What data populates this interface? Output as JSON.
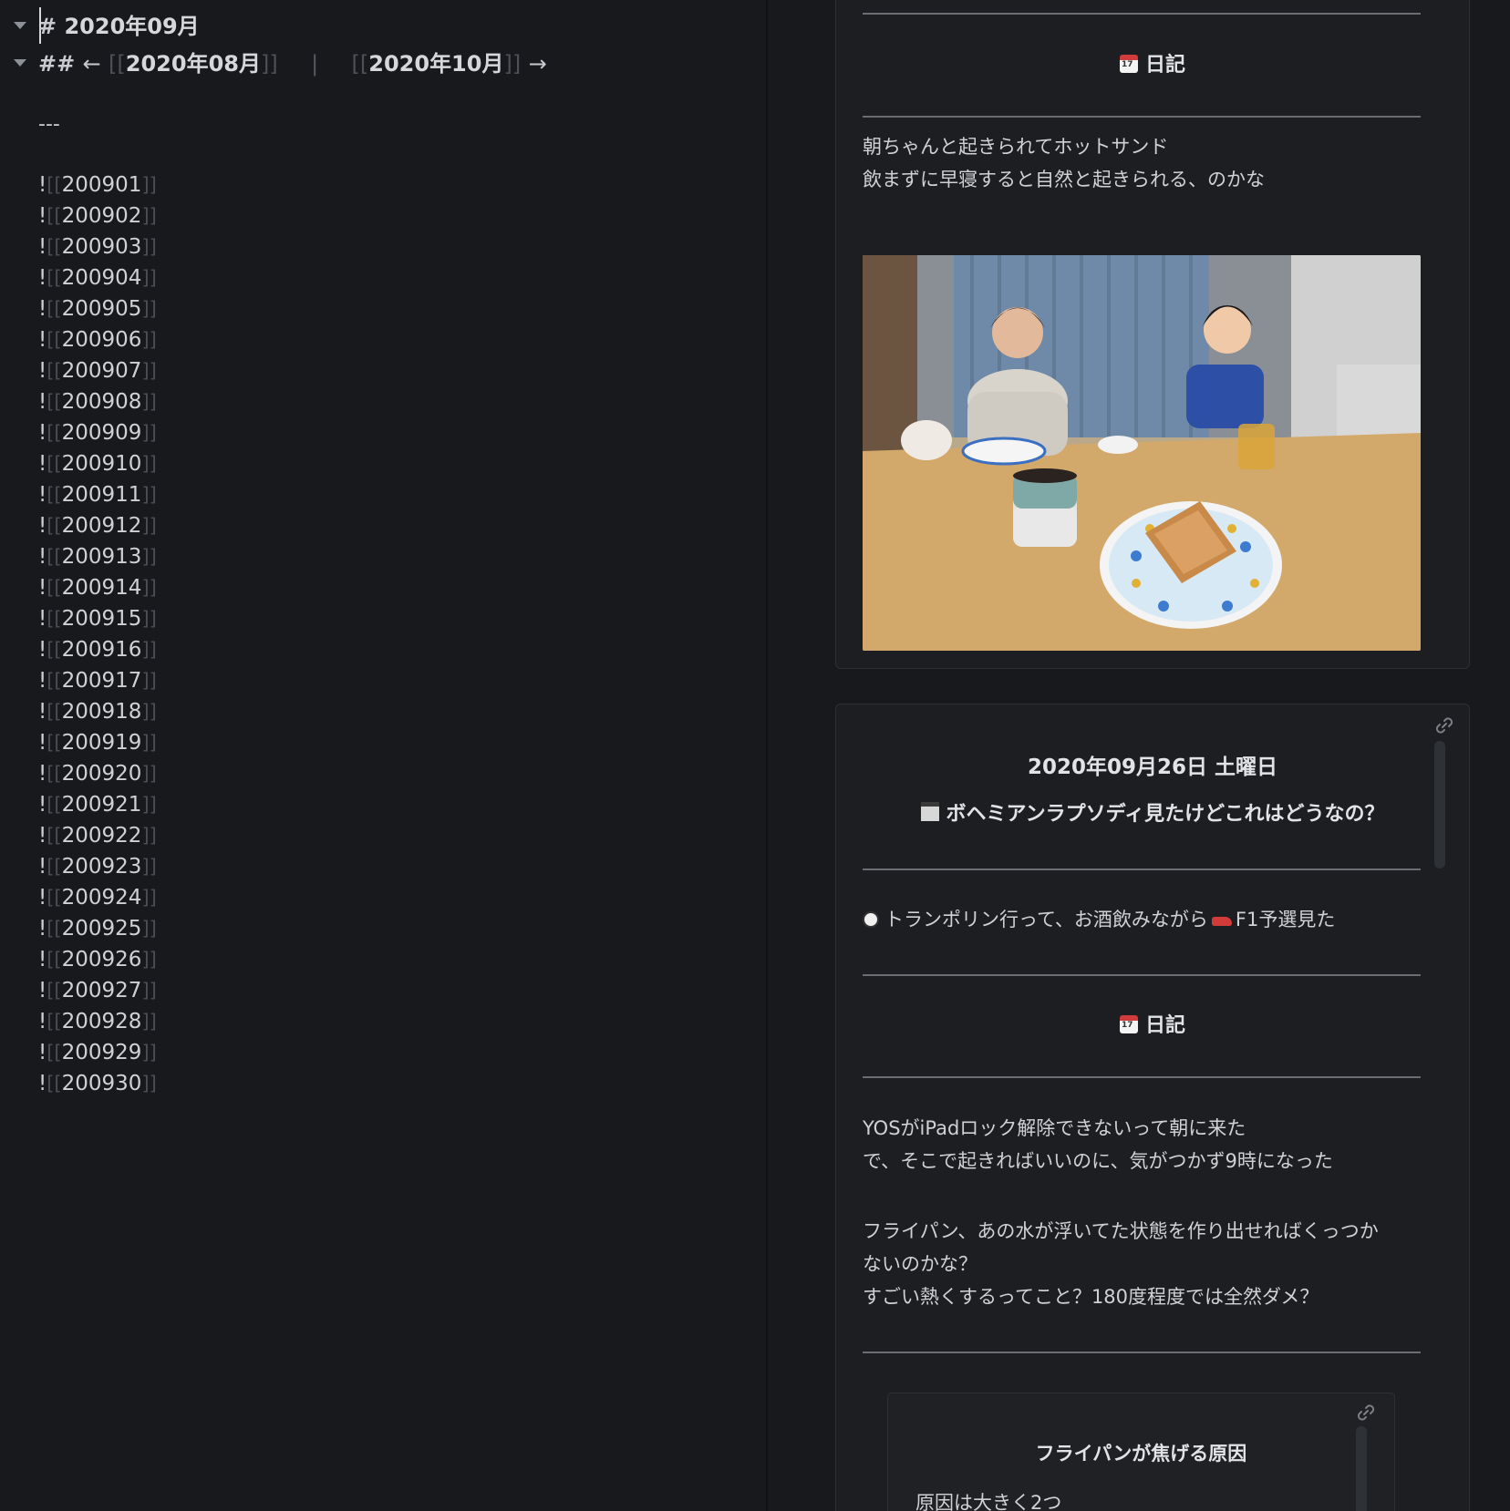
{
  "editor": {
    "h1": {
      "marker": "#",
      "text": "2020年09月"
    },
    "h2": {
      "marker": "##",
      "left_arrow": "←",
      "prev_link": "2020年08月",
      "separator": "|",
      "next_link": "2020年10月",
      "right_arrow": "→"
    },
    "hr": "---",
    "embeds": [
      "200901",
      "200902",
      "200903",
      "200904",
      "200905",
      "200906",
      "200907",
      "200908",
      "200909",
      "200910",
      "200911",
      "200912",
      "200913",
      "200914",
      "200915",
      "200916",
      "200917",
      "200918",
      "200919",
      "200920",
      "200921",
      "200922",
      "200923",
      "200924",
      "200925",
      "200926",
      "200927",
      "200928",
      "200929",
      "200930"
    ]
  },
  "preview": {
    "card1": {
      "heading": "日記",
      "lines": [
        "朝ちゃんと起きられてホットサンド",
        "飲まずに早寝すると自然と起きられる、のかな"
      ]
    },
    "card2": {
      "date": "2020年09月26日 土曜日",
      "movie": "ボヘミアンラプソディ見たけどこれはどうなの？",
      "activity_a": "トランポリン行って、お酒飲みながら",
      "activity_b": "F1予選見た",
      "heading": "日記",
      "para1": [
        "YOSがiPadロック解除できないって朝に来た",
        "で、そこで起きればいいのに、気がつかず9時になった"
      ],
      "para2": [
        "フライパン、あの水が浮いてた状態を作り出せればくっつか",
        "ないのかな？",
        "すごい熱くするってこと？180度程度では全然ダメ？"
      ],
      "embed": {
        "title": "フライパンが焦げる原因",
        "line1": "原因は大きく2つ"
      }
    }
  },
  "icons": {
    "fold": "chevron-down-icon",
    "link": "link-icon",
    "calendar": "calendar-emoji-icon",
    "clapper": "clapper-board-emoji-icon",
    "soccer": "soccer-ball-emoji-icon",
    "racecar": "racing-car-emoji-icon"
  }
}
